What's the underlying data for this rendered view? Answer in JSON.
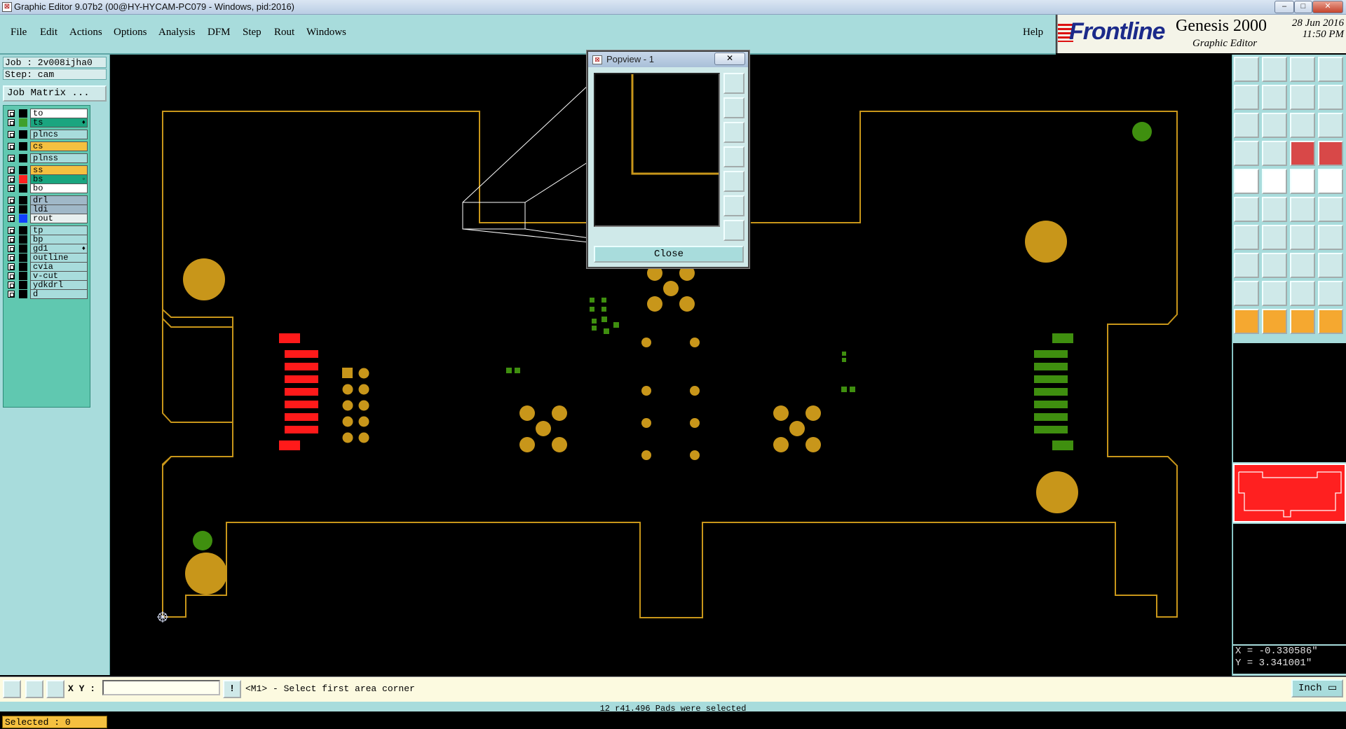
{
  "window": {
    "title": "Graphic Editor 9.07b2 (00@HY-HYCAM-PC079 - Windows, pid:2016)",
    "buttons": [
      "–",
      "□",
      "✕"
    ]
  },
  "menu": {
    "items": [
      "File",
      "Edit",
      "Actions",
      "Options",
      "Analysis",
      "DFM",
      "Step",
      "Rout",
      "Windows"
    ],
    "help": "Help"
  },
  "logo": {
    "brand": "Frontline",
    "product": "Genesis 2000",
    "subtitle": "Graphic Editor",
    "date": "28 Jun 2016",
    "time": "11:50 PM"
  },
  "job": {
    "job_line": "Job : 2v008ijha0",
    "step_line": "Step: cam",
    "job_matrix": "Job Matrix ..."
  },
  "layers": [
    {
      "name": "to",
      "color": "#000000",
      "bg": "#ffffff"
    },
    {
      "name": "ts",
      "color": "#3fa02a",
      "bg": "#1aa57f",
      "marker": "♦"
    },
    {
      "name": "plncs",
      "color": "#000000",
      "bg": "#a8dcdc"
    },
    {
      "name": "cs",
      "color": "#000000",
      "bg": "#f5c040"
    },
    {
      "name": "plnss",
      "color": "#000000",
      "bg": "#a8dcdc"
    },
    {
      "name": "ss",
      "color": "#000000",
      "bg": "#f5c040"
    },
    {
      "name": "bs",
      "color": "#ff2020",
      "bg": "#1aa57f",
      "marker": "▫"
    },
    {
      "name": "bo",
      "color": "#000000",
      "bg": "#ffffff"
    },
    {
      "name": "drl",
      "color": "#000000",
      "bg": "#a0b8c8"
    },
    {
      "name": "ldi",
      "color": "#000000",
      "bg": "#a0b8c8"
    },
    {
      "name": "rout",
      "color": "#1040ff",
      "bg": "#e8f0f0"
    },
    {
      "name": "tp",
      "color": "#000000",
      "bg": "#a8dcdc"
    },
    {
      "name": "bp",
      "color": "#000000",
      "bg": "#a8dcdc"
    },
    {
      "name": "gd1",
      "color": "#000000",
      "bg": "#a8dcdc",
      "marker": "♦"
    },
    {
      "name": "outline",
      "color": "#000000",
      "bg": "#a8dcdc"
    },
    {
      "name": "cvia",
      "color": "#000000",
      "bg": "#a8dcdc"
    },
    {
      "name": "v-cut",
      "color": "#000000",
      "bg": "#a8dcdc"
    },
    {
      "name": "ydkdrl",
      "color": "#000000",
      "bg": "#a8dcdc"
    },
    {
      "name": "d",
      "color": "#000000",
      "bg": "#a8dcdc"
    }
  ],
  "selected_label": "Selected : 0",
  "popview": {
    "title": "Popview - 1",
    "close_x": "✕",
    "close_button": "Close"
  },
  "bottom": {
    "xy_label": "X Y :",
    "xy_value": "",
    "prompt": "<M1> - Select first area corner",
    "unit": "Inch ▭",
    "excl": "!"
  },
  "coords": {
    "x": "X = -0.330586\"",
    "y": "Y = 3.341001\""
  },
  "status_text": "12 r41.496 Pads were selected",
  "colors": {
    "board_outline": "#c8961a",
    "copper_gold": "#c8961a",
    "solder_green": "#3f8f0f",
    "red_layer": "#ff1a1a",
    "panel_cyan": "#a8dcdc"
  },
  "toolbar_icons": [
    "zoom-home-icon",
    "zoom-out-icon",
    "house-icon",
    "window-grid-icon",
    "pan-left-icon",
    "pan-right-icon",
    "flip-icon",
    "snake-icon",
    "fit-view-icon",
    "center-icon",
    "scale-1-2-icon",
    "help-question-icon",
    "ruler-icon",
    "grid-icon",
    "layer-red-icon",
    "layer-blue-icon",
    "pad-add-icon",
    "line-red-icon",
    "measure-icon",
    "dot-icon",
    "node-icon",
    "cross-icon",
    "connect-icon",
    "link-icon",
    "angle-icon",
    "slash-icon",
    "arc-icon",
    "split-icon",
    "dot-blue-icon",
    "dash-icon",
    "resize-icon",
    "circles-icon",
    "triangle-icon",
    "font-a-icon",
    "bridge-icon",
    "arch-icon",
    "pointer-icon",
    "pointer-red-icon",
    "pointer-box-icon",
    "pointer-move-icon"
  ]
}
